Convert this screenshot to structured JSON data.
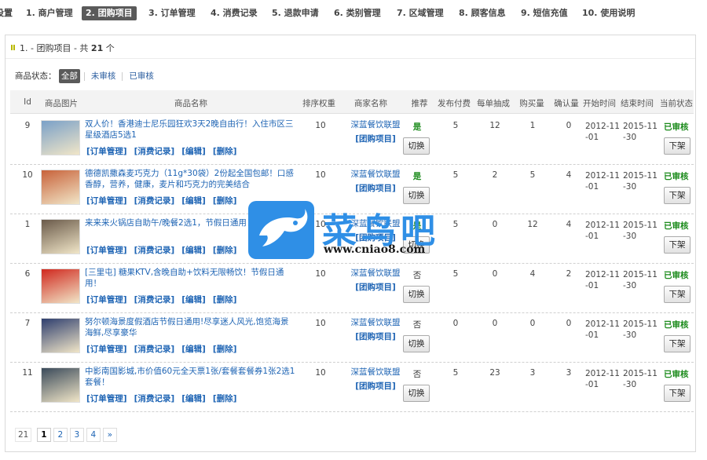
{
  "nav": {
    "items": [
      {
        "label": "设置"
      },
      {
        "label": "1. 商户管理"
      },
      {
        "label": "2. 团购项目"
      },
      {
        "label": "3. 订单管理"
      },
      {
        "label": "4. 消费记录"
      },
      {
        "label": "5. 退款申请"
      },
      {
        "label": "6. 类别管理"
      },
      {
        "label": "7. 区域管理"
      },
      {
        "label": "8. 顾客信息"
      },
      {
        "label": "9. 短信充值"
      },
      {
        "label": "10. 使用说明"
      }
    ],
    "active_index": 2
  },
  "panel": {
    "title_prefix": "1. - 团购项目 - 共",
    "count": "21",
    "title_suffix": "个"
  },
  "filter": {
    "label": "商品状态：",
    "options": [
      {
        "label": "全部"
      },
      {
        "label": "未审核"
      },
      {
        "label": "已审核"
      }
    ],
    "active_index": 0
  },
  "table": {
    "columns": [
      "Id",
      "商品图片",
      "商品名称",
      "排序权重",
      "商家名称",
      "推荐",
      "发布付费",
      "每单抽成",
      "购买量",
      "确认量",
      "开始时间",
      "结束时间",
      "当前状态"
    ],
    "action_labels": [
      "[订单管理]",
      "[消费记录]",
      "[编辑]",
      "[删除]"
    ],
    "merchant_tag": "[团购项目]",
    "toggle_label": "切换",
    "shelf_label": "下架",
    "rows": [
      {
        "id": "9",
        "name": "双人价！香港迪士尼乐园狂欢3天2晚自由行！入住市区三星级酒店5选1",
        "weight": "10",
        "merchant": "深蓝餐饮联盟",
        "recommend": "是",
        "fee": "5",
        "commission": "12",
        "bought": "1",
        "confirmed": "0",
        "start": "2012-11-01",
        "end": "2015-11-30",
        "status": "已审核",
        "thumb_color": "#7aa0c8"
      },
      {
        "id": "10",
        "name": "德德凯撒森麦巧克力（11g*30袋）2份起全国包邮！口感香醇，营养，健康，麦片和巧克力的完美结合",
        "weight": "10",
        "merchant": "深蓝餐饮联盟",
        "recommend": "是",
        "fee": "5",
        "commission": "2",
        "bought": "5",
        "confirmed": "4",
        "start": "2012-11-01",
        "end": "2015-11-30",
        "status": "已审核",
        "thumb_color": "#c8623a"
      },
      {
        "id": "1",
        "name": "来来来火锅店自助午/晚餐2选1，节假日通用！",
        "weight": "10",
        "merchant": "深蓝餐饮联盟",
        "recommend": "是",
        "fee": "5",
        "commission": "0",
        "bought": "12",
        "confirmed": "4",
        "start": "2012-11-01",
        "end": "2015-11-30",
        "status": "已审核",
        "thumb_color": "#6a5a4a"
      },
      {
        "id": "6",
        "name": "[三里屯] 糖果KTV,含晚自助+饮料无限畅饮！节假日通用！",
        "weight": "10",
        "merchant": "深蓝餐饮联盟",
        "recommend": "否",
        "fee": "5",
        "commission": "0",
        "bought": "4",
        "confirmed": "2",
        "start": "2012-11-01",
        "end": "2015-11-30",
        "status": "已审核",
        "thumb_color": "#d0281e"
      },
      {
        "id": "7",
        "name": "努尔顿海景度假酒店节假日通用!尽享迷人风光,饱览海景海鲜,尽享豪华",
        "weight": "10",
        "merchant": "深蓝餐饮联盟",
        "recommend": "否",
        "fee": "0",
        "commission": "0",
        "bought": "0",
        "confirmed": "0",
        "start": "2012-11-01",
        "end": "2015-11-30",
        "status": "已审核",
        "thumb_color": "#2e3e6e"
      },
      {
        "id": "11",
        "name": "中影南国影城,市价值60元全天票1张/套餐套餐券1张2选1套餐！",
        "weight": "10",
        "merchant": "深蓝餐饮联盟",
        "recommend": "否",
        "fee": "5",
        "commission": "23",
        "bought": "3",
        "confirmed": "3",
        "start": "2012-11-01",
        "end": "2015-11-30",
        "status": "已审核",
        "thumb_color": "#3a4a5a"
      }
    ]
  },
  "pager": {
    "total": "21",
    "pages": [
      "1",
      "2",
      "3",
      "4",
      "»"
    ],
    "active_index": 0
  },
  "watermark": {
    "text": "菜鸟吧",
    "url": "www.cniao8.com"
  }
}
